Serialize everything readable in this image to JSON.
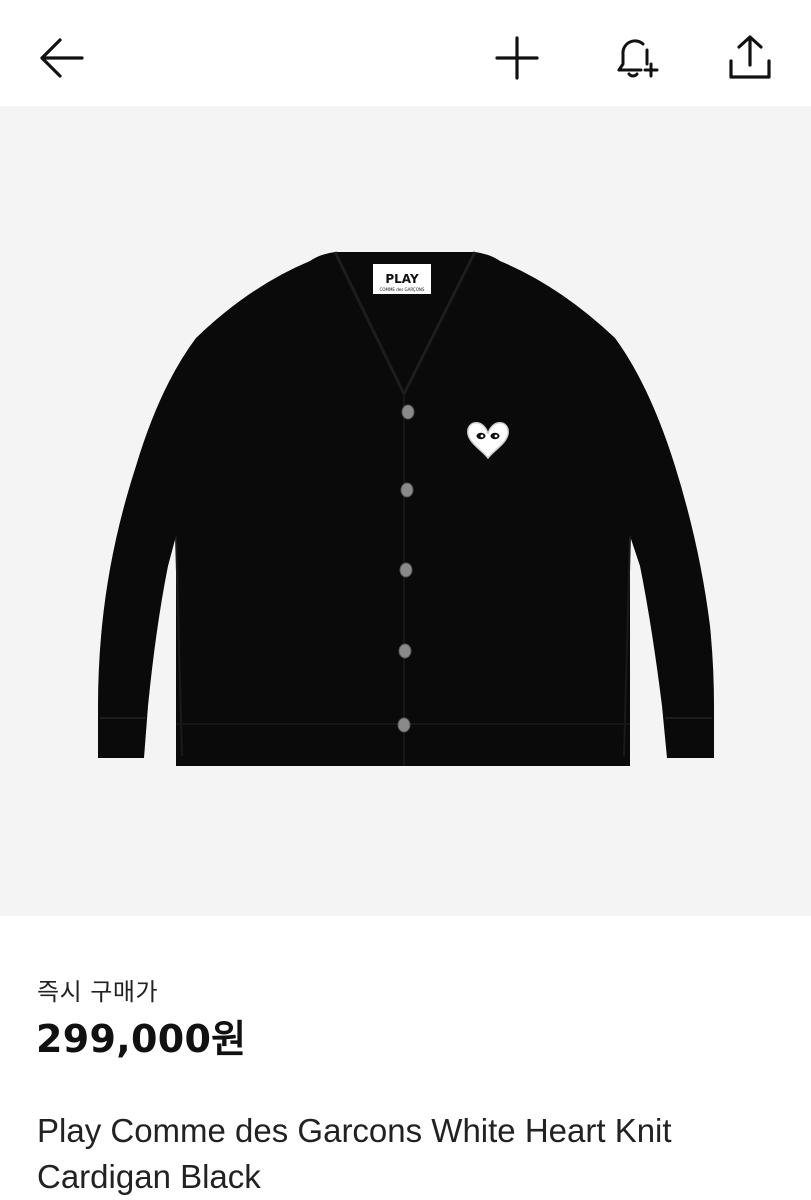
{
  "header": {
    "back_icon": "arrow-left-icon",
    "add_icon": "plus-icon",
    "alert_icon": "bell-plus-icon",
    "share_icon": "share-upload-icon"
  },
  "product_image": {
    "tag_text": "PLAY",
    "tag_subtext": "COMME des GARÇONS"
  },
  "product": {
    "price_label": "즉시 구매가",
    "price": "299,000원",
    "name": "Play Comme des Garcons White Heart Knit Cardigan Black"
  },
  "colors": {
    "image_background": "#f4f4f4",
    "garment": "#0a0a0a",
    "text": "#111111"
  }
}
